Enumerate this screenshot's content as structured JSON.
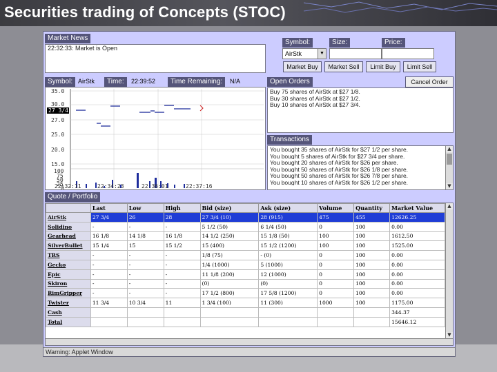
{
  "slide_title": "Securities trading of Concepts (STOC)",
  "market_news": {
    "label": "Market News",
    "lines": [
      "22:32:33: Market is Open"
    ]
  },
  "order_entry": {
    "symbol_label": "Symbol:",
    "symbol_value": "AirStk",
    "size_label": "Size:",
    "size_value": "",
    "price_label": "Price:",
    "price_value": "",
    "buttons": [
      "Market Buy",
      "Market Sell",
      "Limit Buy",
      "Limit Sell"
    ]
  },
  "chart_panel": {
    "symbol_label": "Symbol:",
    "symbol_value": "AirStk",
    "time_label": "Time:",
    "time_value": "22:39:52",
    "remaining_label": "Time Remaining:",
    "remaining_value": "N/A",
    "price_axis": [
      "35.0",
      "30.0",
      "27.0",
      "25.0",
      "20.0",
      "15.0"
    ],
    "volume_axis": [
      "100",
      "75",
      "50",
      "25",
      "0"
    ],
    "time_axis": [
      "22:32:11",
      "22:34:23",
      "22:36:01",
      "22:37:16"
    ],
    "last_price_tag": "27 3/4"
  },
  "open_orders": {
    "label": "Open Orders",
    "cancel_label": "Cancel Order",
    "lines": [
      "Buy 75 shares of AirStk at $27 1/8.",
      "Buy 30 shares of AirStk at $27 1/2.",
      "Buy 10 shares of AirStk at $27 3/4."
    ]
  },
  "transactions": {
    "label": "Transactions",
    "lines": [
      "You bought 35 shares of AirStk for $27 1/2 per share.",
      "You bought 5 shares of AirStk for $27 3/4 per share.",
      "You bought 20 shares of AirStk for $26 per share.",
      "You bought 50 shares of AirStk for $26 1/8 per share.",
      "You bought 50 shares of AirStk for $26 7/8 per share.",
      "You bought 10 shares of AirStk for $26 1/2 per share."
    ]
  },
  "portfolio": {
    "label": "Quote / Portfolio",
    "columns": [
      "",
      "Last",
      "Low",
      "High",
      "Bid (size)",
      "Ask (size)",
      "Volume",
      "Quantity",
      "Market Value"
    ],
    "rows": [
      [
        "AirStk",
        "27 3/4",
        "26",
        "28",
        "27 3/4 (10)",
        "28 (915)",
        "475",
        "455",
        "12626.25"
      ],
      [
        "Solidino",
        "-",
        "-",
        "-",
        "5 1/2 (50)",
        "6 1/4 (50)",
        "0",
        "100",
        "0.00"
      ],
      [
        "Gearhead",
        "16 1/8",
        "14 1/8",
        "16 1/8",
        "14 1/2 (250)",
        "15 1/8 (50)",
        "100",
        "100",
        "1612.50"
      ],
      [
        "SilverBullet",
        "15 1/4",
        "15",
        "15 1/2",
        "15 (400)",
        "15 1/2 (1200)",
        "100",
        "100",
        "1525.00"
      ],
      [
        "TRS",
        "-",
        "-",
        "-",
        "1/8 (75)",
        "- (0)",
        "0",
        "100",
        "0.00"
      ],
      [
        "Gecko",
        "-",
        "-",
        "-",
        "1/4 (1000)",
        "5 (1000)",
        "0",
        "100",
        "0.00"
      ],
      [
        "Epic",
        "-",
        "-",
        "-",
        "11 1/8 (200)",
        "12 (1000)",
        "0",
        "100",
        "0.00"
      ],
      [
        "Skiron",
        "-",
        "-",
        "-",
        "(0)",
        "(0)",
        "0",
        "100",
        "0.00"
      ],
      [
        "RimGripper",
        "-",
        "-",
        "-",
        "17 1/2 (800)",
        "17 5/8 (1200)",
        "0",
        "100",
        "0.00"
      ],
      [
        "Twister",
        "11 3/4",
        "10 3/4",
        "11",
        "1 3/4 (100)",
        "11 (300)",
        "1000",
        "100",
        "1175.00"
      ],
      [
        "Cash",
        "",
        "",
        "",
        "",
        "",
        "",
        "",
        "344.37"
      ],
      [
        "Total",
        "",
        "",
        "",
        "",
        "",
        "",
        "",
        "15646.12"
      ]
    ]
  },
  "status_bar": "Warning: Applet Window"
}
